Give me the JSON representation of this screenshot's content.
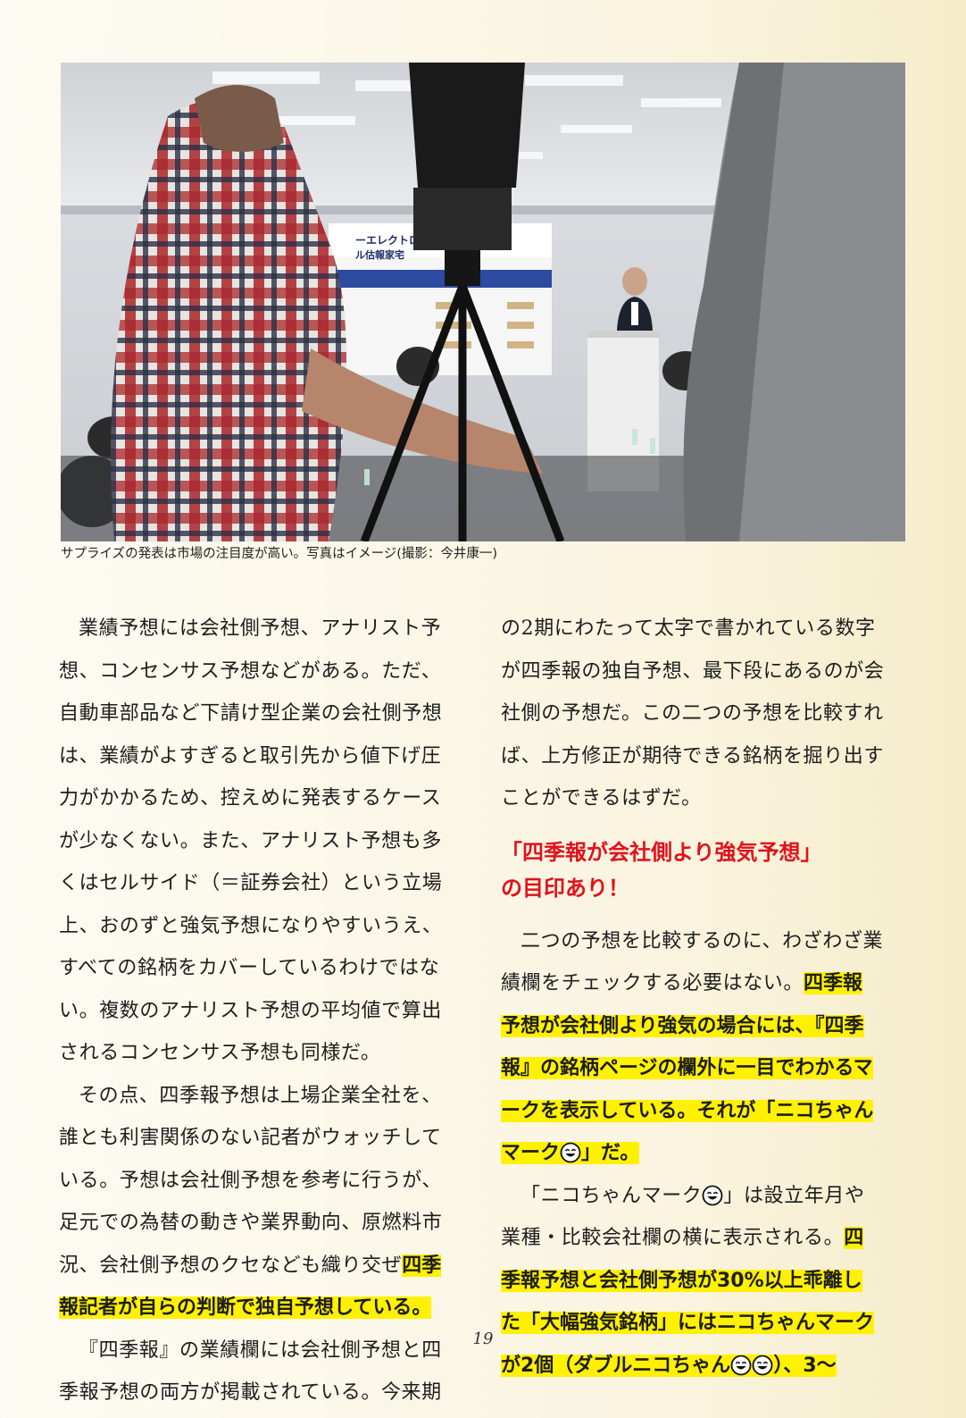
{
  "photo": {
    "screen_text_1": "ーエレクトロ",
    "screen_text_2": "ル估報家宅"
  },
  "caption": "サプライズの発表は市場の注目度が高い。写真はイメージ(撮影：今井康一)",
  "left_column": [
    {
      "text": "業績予想には会社側予想、アナリスト予"
    },
    {
      "text": "想、コンセンサス予想などがある。ただ、"
    },
    {
      "text": "自動車部品など下請け型企業の会社側予想"
    },
    {
      "text": "は、業績がよすぎると取引先から値下げ圧"
    },
    {
      "text": "力がかかるため、控えめに発表するケース"
    },
    {
      "text": "が少なくない。また、アナリスト予想も多"
    },
    {
      "text": "くはセルサイド（＝証券会社）という立場"
    },
    {
      "text": "上、おのずと強気予想になりやすいうえ、"
    },
    {
      "text": "すべての銘柄をカバーしているわけではな"
    },
    {
      "text": "い。複数のアナリスト予想の平均値で算出"
    },
    {
      "text": "されるコンセンサス予想も同様だ。"
    },
    {
      "text": "その点、四季報予想は上場企業全社を、"
    },
    {
      "text": "誰とも利害関係のない記者がウォッチして"
    },
    {
      "text": "いる。予想は会社側予想を参考に行うが、"
    },
    {
      "text": "足元での為替の動きや業界動向、原燃料市"
    },
    {
      "text": "況、会社側予想のクセなども織り交ぜ",
      "hl": "四季"
    },
    {
      "text": "",
      "hl": "報記者が自らの判断で独自予想している。"
    },
    {
      "text": "『四季報』の業績欄には会社側予想と四"
    },
    {
      "text": "季報予想の両方が掲載されている。今来期"
    }
  ],
  "right_column_top": [
    {
      "text": "の2期にわたって太字で書かれている数字"
    },
    {
      "text": "が四季報の独自予想、最下段にあるのが会"
    },
    {
      "text": "社側の予想だ。この二つの予想を比較すれ"
    },
    {
      "text": "ば、上方修正が期待できる銘柄を掘り出す"
    },
    {
      "text": "ことができるはずだ。"
    }
  ],
  "heading": {
    "line1": "「四季報が会社側より強気予想」",
    "line2": "の目印あり！"
  },
  "right_column_bottom": [
    {
      "text": "二つの予想を比較するのに、わざわざ業"
    },
    {
      "text": "績欄をチェックする必要はない。",
      "hl": "四季報"
    },
    {
      "text": "",
      "hl": "予想が会社側より強気の場合には、『四季"
    },
    {
      "text": "",
      "hl": "報』の銘柄ページの欄外に一目でわかるマ"
    },
    {
      "text": "",
      "hl": "ークを表示している。それが「ニコちゃん"
    },
    {
      "text": "",
      "hl": "マーク",
      "smile_after": 1,
      "hl_after": "」だ。"
    },
    {
      "text": "「ニコちゃんマーク",
      "smile_after": 1,
      "text_after": "」は設立年月や"
    },
    {
      "text": "業種・比較会社欄の横に表示される。",
      "hl": "四"
    },
    {
      "text": "",
      "hl": "季報予想と会社側予想が30%以上乖離し"
    },
    {
      "text": "",
      "hl": "た「大幅強気銘柄」にはニコちゃんマーク"
    },
    {
      "text": "",
      "hl": "が2個（ダブルニコちゃん",
      "smile_after": 2,
      "hl_after": "）、3～"
    }
  ],
  "page_number": "19"
}
